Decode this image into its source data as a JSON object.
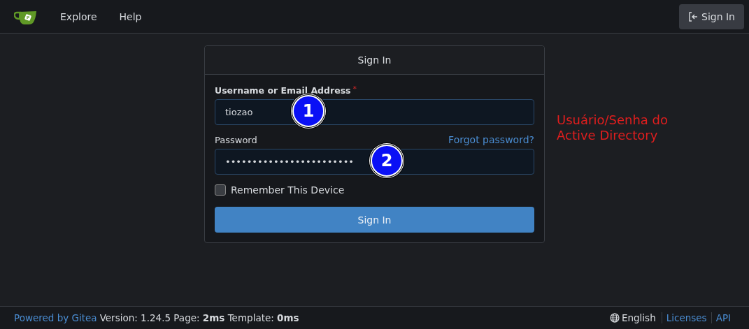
{
  "navbar": {
    "links": [
      {
        "label": "Explore"
      },
      {
        "label": "Help"
      }
    ],
    "sign_in_button": {
      "label": "Sign In"
    }
  },
  "login_card": {
    "title": "Sign In",
    "fields": [
      {
        "label": "Username or Email Address",
        "required_mark": "*",
        "value": "tiozao",
        "marker": "1"
      },
      {
        "label": "Password",
        "value": "••••••••••••••••••••••••",
        "link": "Forgot password?",
        "marker": "2"
      }
    ],
    "remember": {
      "label": "Remember This Device",
      "checked": false
    },
    "submit": "Sign In"
  },
  "note": "Usuário/Senha do Active Directory",
  "footer": {
    "powered": "Powered by Gitea",
    "version": "Version: 1.24.5 Page: **2ms** Template: **0ms**",
    "language": "English",
    "links": [
      "Licenses",
      "API"
    ]
  }
}
